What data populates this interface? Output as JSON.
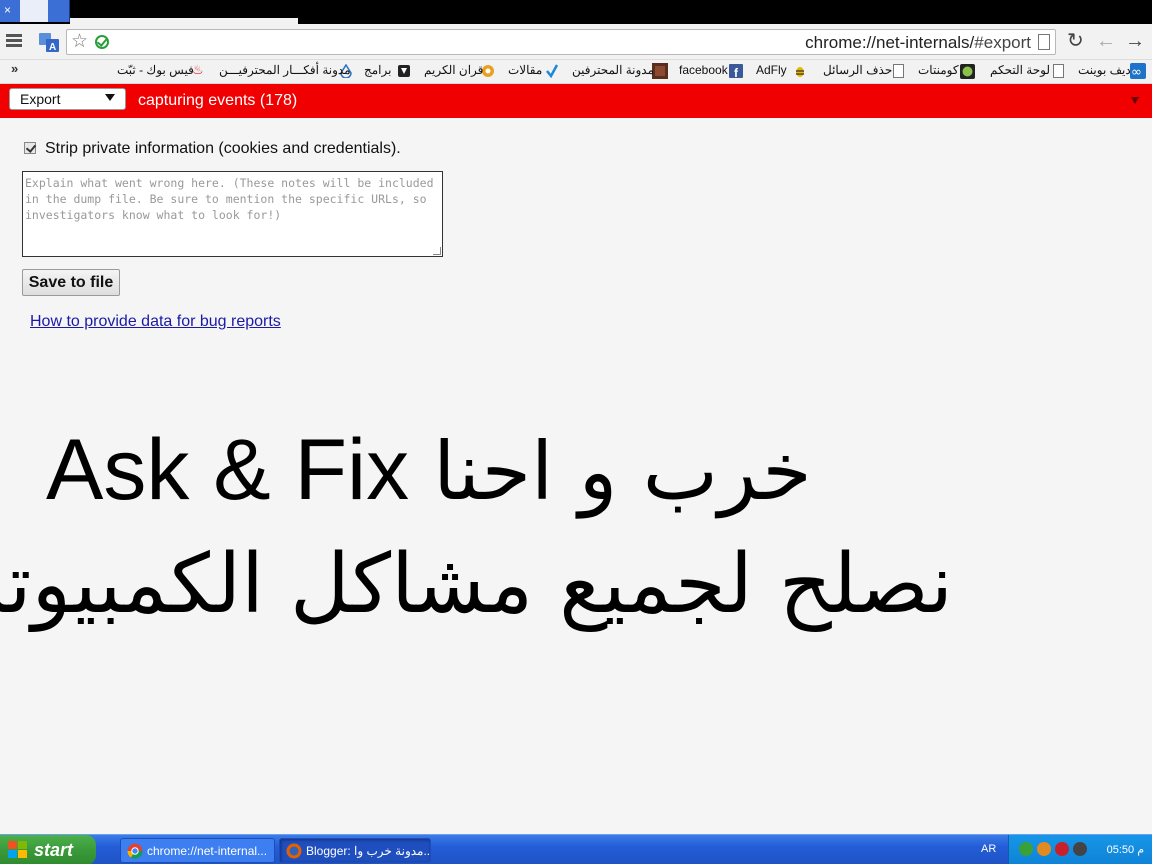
{
  "browser": {
    "tab_close": "×",
    "url_host": "chrome://net-internals/",
    "url_hash": "#export"
  },
  "bookmarks": {
    "more": "»",
    "items": [
      {
        "label": "فيس بوك - ثبّت",
        "icon": "gift-icon"
      },
      {
        "label": "مدونة أفكـــار المحترفيـــن",
        "icon": "drop-icon"
      },
      {
        "label": "برامج",
        "icon": "cube-icon"
      },
      {
        "label": "قران الكريم",
        "icon": "gear-icon"
      },
      {
        "label": "مقالات",
        "icon": "check-icon"
      },
      {
        "label": "مدونة المحترفين",
        "icon": "image-icon"
      },
      {
        "label": "facebook",
        "icon": "facebook-icon"
      },
      {
        "label": "AdFly",
        "icon": "bee-icon"
      },
      {
        "label": "حذف الرسائل",
        "icon": "page-icon"
      },
      {
        "label": "كومنتات",
        "icon": "circle-icon"
      },
      {
        "label": "لوحة التحكم",
        "icon": "page-icon"
      },
      {
        "label": "ديف بوينت",
        "icon": "infinity-icon"
      }
    ]
  },
  "header": {
    "select_value": "Export",
    "status": "capturing events (178)"
  },
  "export": {
    "strip_label": "Strip private information (cookies and credentials).",
    "strip_checked": true,
    "notes_placeholder": "Explain what went wrong here. (These notes will be included in the dump file. Be sure to mention the specific URLs, so investigators know what to look for!)",
    "save_label": "Save to file",
    "help_link": "How to provide data for bug reports"
  },
  "overlay": {
    "line1_latin": "Ask & Fix",
    "line1_arabic": "خرب و احنا",
    "line2": "نصلح لجميع مشاكل الكمبيوتر"
  },
  "taskbar": {
    "start": "start",
    "tasks": [
      {
        "label": "chrome://net-internal..."
      },
      {
        "label": "Blogger: مدونة خرب وا..."
      }
    ],
    "lang": "AR",
    "clock": "05:50 م"
  },
  "colors": {
    "header_red": "#f00000",
    "link": "#1a1aa6",
    "taskbar": "#245dd7",
    "start_green": "#3a9a3a"
  }
}
